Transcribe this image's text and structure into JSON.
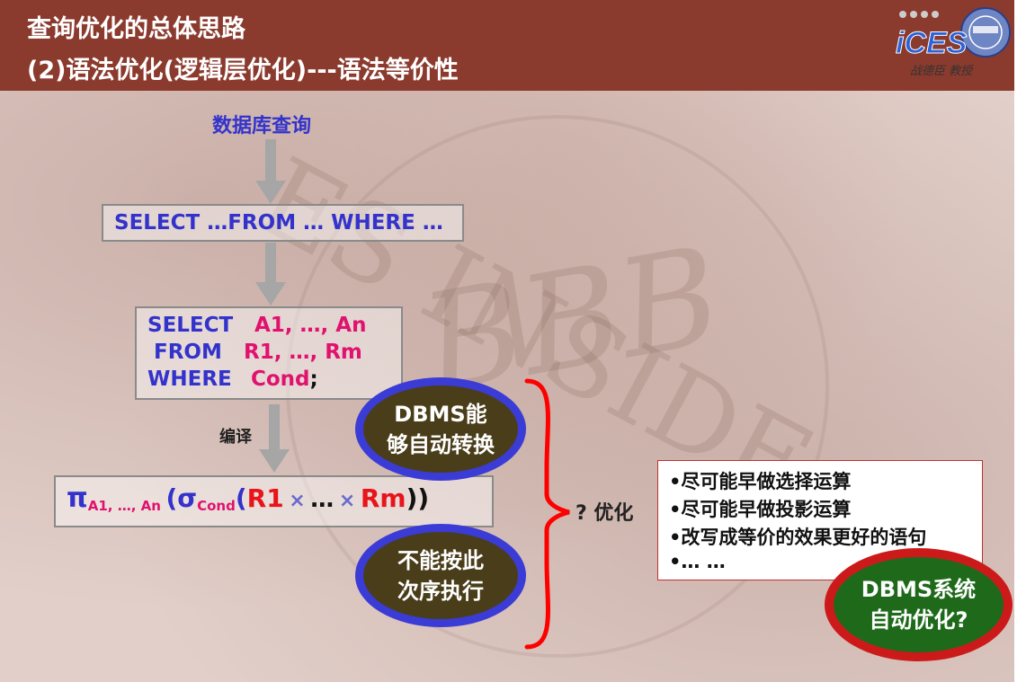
{
  "header": {
    "title_line1": "查询优化的总体思路",
    "title_line2": "(2)语法优化(逻辑层优化)---语法等价性",
    "logo_text": "战德臣 教授",
    "logo_letters": "iCES"
  },
  "diagram": {
    "database_query": "数据库查询",
    "template_sql": "SELECT …FROM … WHERE …",
    "sql": {
      "select_kw": "SELECT",
      "select_args": "A1, …, An",
      "from_kw": "FROM",
      "from_args": "R1, …, Rm",
      "where_kw": "WHERE",
      "where_args": "Cond",
      "terminator": ";"
    },
    "compile_label": "编译",
    "formula": {
      "pi": "π",
      "pi_sub": "A1, …, An",
      "open": "(",
      "sigma": "σ",
      "sigma_sub": "Cond",
      "open2": "(",
      "r1": "R1",
      "times1": "×",
      "dots": "…",
      "times2": "×",
      "rm": "Rm",
      "close": "))"
    },
    "ellipse_top": {
      "line1": "DBMS能",
      "line2": "够自动转换"
    },
    "ellipse_bottom": {
      "line1": "不能按此",
      "line2": "次序执行"
    },
    "optimize_label": "? 优化",
    "tips": [
      "•尽可能早做选择运算",
      "•尽可能早做投影运算",
      "•改写成等价的效果更好的语句",
      "•… …"
    ],
    "ellipse_right": {
      "line1": "DBMS系统",
      "line2": "自动优化?"
    }
  },
  "watermark": {
    "text1": "ES INSIDE",
    "text2": "BBB"
  },
  "colors": {
    "header": "#8b3a2e",
    "keyword_blue": "#3333cc",
    "value_pink": "#e0126e",
    "relation_red": "#e8141a",
    "brace_red": "#ff0000"
  }
}
